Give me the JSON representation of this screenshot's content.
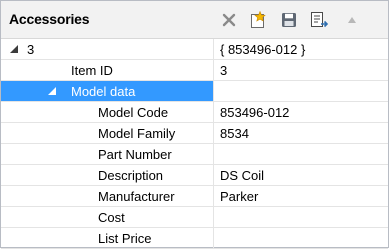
{
  "panel": {
    "title": "Accessories",
    "toolbar": [
      {
        "icon": "close-x-icon",
        "color": "#8a8a8a"
      },
      {
        "icon": "new-document-star-icon",
        "color": "#e8a800"
      },
      {
        "icon": "save-floppy-icon",
        "color": "#6b7480"
      },
      {
        "icon": "export-list-icon",
        "color": "#2f6fb0"
      }
    ]
  },
  "grid": {
    "rows": [
      {
        "name": "3",
        "value": "{ 853496-012 }"
      },
      {
        "name": "Item ID",
        "value": "3"
      },
      {
        "name": "Model data",
        "value": ""
      },
      {
        "name": "Model Code",
        "value": "853496-012"
      },
      {
        "name": "Model Family",
        "value": "8534"
      },
      {
        "name": "Part Number",
        "value": ""
      },
      {
        "name": "Description",
        "value": "DS Coil"
      },
      {
        "name": "Manufacturer",
        "value": "Parker"
      },
      {
        "name": "Cost",
        "value": ""
      },
      {
        "name": "List Price",
        "value": ""
      }
    ]
  },
  "colors": {
    "selection": "#3399ff",
    "grid_line": "#e4e4e4",
    "header_bg": "#f2f2f2"
  }
}
